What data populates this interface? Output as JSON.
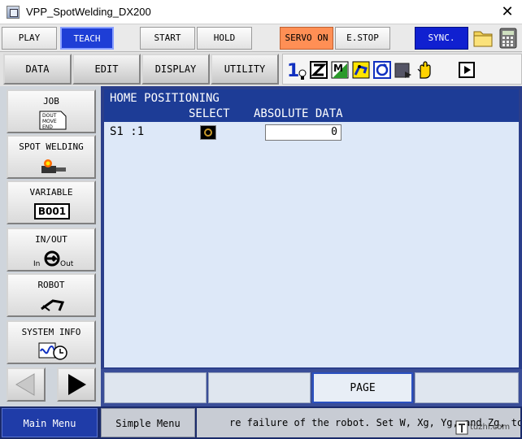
{
  "window": {
    "title": "VPP_SpotWelding_DX200"
  },
  "modebar": {
    "play": "PLAY",
    "teach": "TEACH",
    "start": "START",
    "hold": "HOLD",
    "servo_on": "SERVO ON",
    "estop": "E.STOP",
    "sync": "SYNC."
  },
  "menubar": {
    "data": "DATA",
    "edit": "EDIT",
    "display": "DISPLAY",
    "utility": "UTILITY",
    "status_number": "1"
  },
  "sidebar": {
    "job": "JOB",
    "job_icon_text": [
      "DOUT",
      "MOVE",
      "END"
    ],
    "spot_welding": "SPOT WELDING",
    "variable": "VARIABLE",
    "variable_badge": "B001",
    "in_out": "IN/OUT",
    "in_label": "In",
    "out_label": "Out",
    "robot": "ROBOT",
    "system_info": "SYSTEM INFO"
  },
  "main": {
    "title": "HOME POSITIONING",
    "col_select": "SELECT",
    "col_absolute": "ABSOLUTE DATA",
    "rows": [
      {
        "axis": "S1 :1",
        "absolute": "0"
      }
    ]
  },
  "softkeys": {
    "page": "PAGE"
  },
  "bottom": {
    "main_menu": "Main Menu",
    "simple_menu": "Simple Menu",
    "message": "re failure of the robot. Set W, Xg, Yg, and Zg, to t",
    "watermark": "tuzhi.com"
  },
  "colors": {
    "teach_bg": "#1e3ed6",
    "servo_bg": "#ff8f55",
    "sync_bg": "#1020d0",
    "panel_header": "#1d3c96",
    "panel_bg": "#dde8f8",
    "main_menu_bg": "#1f3ca8"
  }
}
